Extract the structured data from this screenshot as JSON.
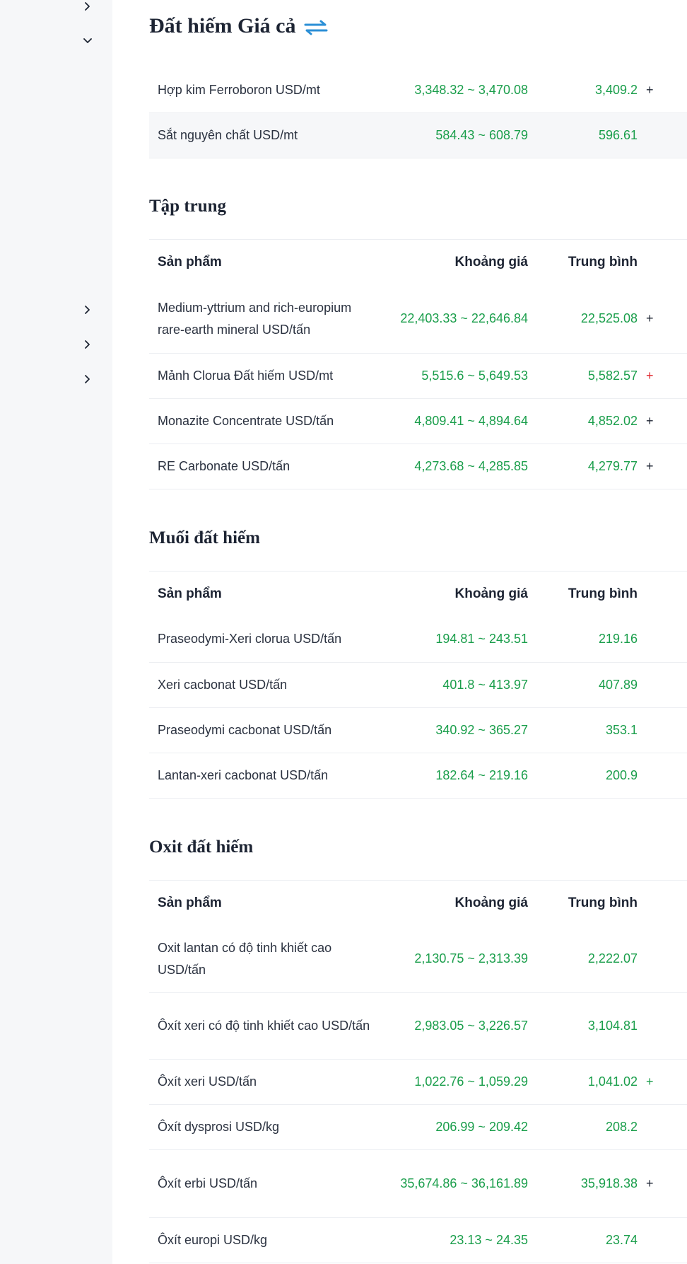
{
  "colors": {
    "green": "#1a9e4b",
    "red": "#e0262d",
    "accent_blue": "#2b8fd6"
  },
  "header": {
    "title": "Đất hiếm Giá cả"
  },
  "columns": {
    "product": "Sản phẩm",
    "range": "Khoảng giá",
    "average": "Trung bình"
  },
  "sections": {
    "top": {
      "rows": [
        {
          "name": "Hợp kim Ferroboron USD/mt",
          "range": "3,348.32 ~ 3,470.08",
          "avg": "3,409.2",
          "chg": "+"
        },
        {
          "name": "Sắt nguyên chất USD/mt",
          "range": "584.43 ~ 608.79",
          "avg": "596.61",
          "chg": ""
        }
      ]
    },
    "concentrate": {
      "title": "Tập trung",
      "rows": [
        {
          "name": "Medium-yttrium and rich-europium rare-earth mineral USD/tấn",
          "range": "22,403.33 ~ 22,646.84",
          "avg": "22,525.08",
          "chg": "+"
        },
        {
          "name": "Mảnh Clorua Đất hiếm USD/mt",
          "range": "5,515.6 ~ 5,649.53",
          "avg": "5,582.57",
          "chg": "+"
        },
        {
          "name": "Monazite Concentrate USD/tấn",
          "range": "4,809.41 ~ 4,894.64",
          "avg": "4,852.02",
          "chg": "+"
        },
        {
          "name": "RE Carbonate USD/tấn",
          "range": "4,273.68 ~ 4,285.85",
          "avg": "4,279.77",
          "chg": "+"
        }
      ]
    },
    "salts": {
      "title": "Muối đất hiếm",
      "rows": [
        {
          "name": "Praseodymi-Xeri clorua USD/tấn",
          "range": "194.81 ~ 243.51",
          "avg": "219.16",
          "chg": ""
        },
        {
          "name": "Xeri cacbonat USD/tấn",
          "range": "401.8 ~ 413.97",
          "avg": "407.89",
          "chg": ""
        },
        {
          "name": "Praseodymi cacbonat USD/tấn",
          "range": "340.92 ~ 365.27",
          "avg": "353.1",
          "chg": ""
        },
        {
          "name": "Lantan-xeri cacbonat USD/tấn",
          "range": "182.64 ~ 219.16",
          "avg": "200.9",
          "chg": ""
        }
      ]
    },
    "oxides": {
      "title": "Oxit đất hiếm",
      "rows": [
        {
          "name": "Oxit lantan có độ tinh khiết cao USD/tấn",
          "range": "2,130.75 ~ 2,313.39",
          "avg": "2,222.07",
          "chg": ""
        },
        {
          "name": "Ôxít xeri có độ tinh khiết cao USD/tấn",
          "range": "2,983.05 ~ 3,226.57",
          "avg": "3,104.81",
          "chg": ""
        },
        {
          "name": "Ôxít xeri USD/tấn",
          "range": "1,022.76 ~ 1,059.29",
          "avg": "1,041.02",
          "chg": "+"
        },
        {
          "name": "Ôxít dysprosi USD/kg",
          "range": "206.99 ~ 209.42",
          "avg": "208.2",
          "chg": ""
        },
        {
          "name": "Ôxít erbi USD/tấn",
          "range": "35,674.86 ~ 36,161.89",
          "avg": "35,918.38",
          "chg": "+"
        },
        {
          "name": "Ôxít europi USD/kg",
          "range": "23.13 ~ 24.35",
          "avg": "23.74",
          "chg": ""
        }
      ]
    }
  },
  "sidebar": {
    "chevrons": [
      "chevron-right-icon",
      "chevron-down-icon",
      "chevron-right-icon",
      "chevron-right-icon",
      "chevron-right-icon"
    ]
  }
}
